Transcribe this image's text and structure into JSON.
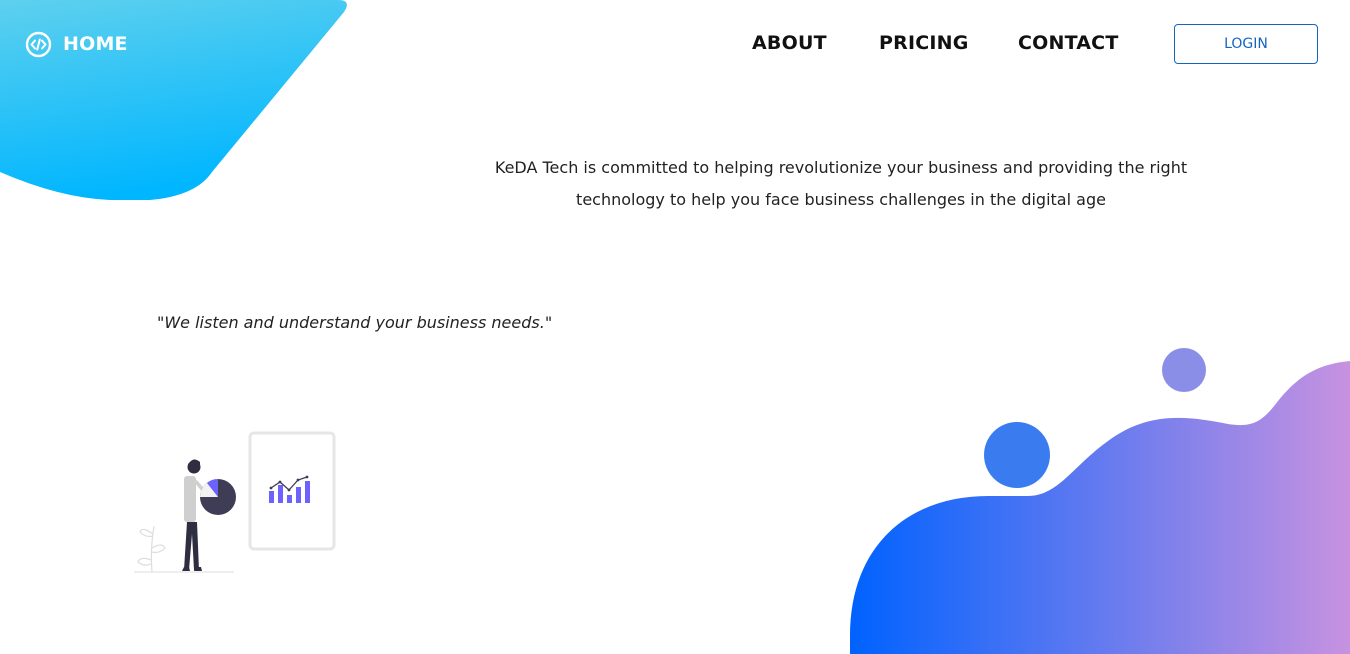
{
  "brand": {
    "home_label": "HOME",
    "icon": "code-brackets-icon"
  },
  "nav": {
    "about_label": "ABOUT",
    "pricing_label": "PRICING",
    "contact_label": "CONTACT",
    "login_label": "LOGIN"
  },
  "hero": {
    "intro_line1": "KeDA Tech is committed to helping revolutionize your business and providing the right",
    "intro_line2": "technology to help you face business challenges in the digital age",
    "quote": "\"We listen and understand your business needs.\""
  },
  "colors": {
    "top_blob_start": "#5ed0ee",
    "top_blob_end": "#00b6ff",
    "bottom_blob_start": "#0062ff",
    "bottom_blob_end": "#c792e0",
    "bubble_blue": "#3a7cf0",
    "bubble_purple": "#8b8ee6",
    "chart_accent": "#6c63ff",
    "login_accent": "#1565c0"
  }
}
